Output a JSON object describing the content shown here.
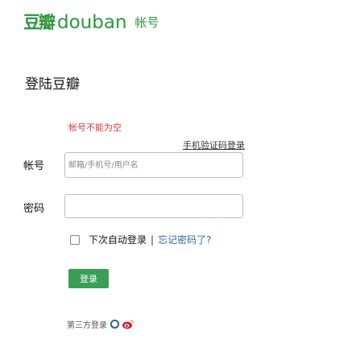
{
  "logo": {
    "cn": "豆瓣",
    "en": "douban",
    "account": "帐号"
  },
  "page_title": "登陆豆瓣",
  "error_message": "帐号不能为空",
  "phone_login_link": "手机验证码登录",
  "form": {
    "account_label": "帐号",
    "account_placeholder": "邮箱/手机号/用户名",
    "account_value": "",
    "password_label": "密码",
    "password_value": ""
  },
  "remember_label": "下次自动登录",
  "separator": "|",
  "forgot_link": "忘记密码了?",
  "login_button": "登录",
  "third_party_label": "第三方登录",
  "colors": {
    "brand_green": "#2e963d",
    "error_red": "#d23b3b",
    "link_blue": "#2e6a9e",
    "button_green": "#3b9e55"
  },
  "icons": [
    "qq-icon",
    "weibo-icon"
  ]
}
